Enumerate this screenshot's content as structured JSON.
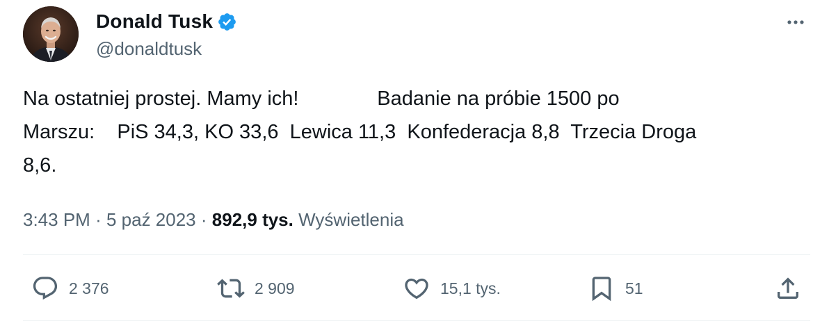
{
  "author": {
    "display_name": "Donald Tusk",
    "handle": "@donaldtusk",
    "verified": true
  },
  "tweet": {
    "line1": "Na ostatniej prostej. Mamy ich!              Badanie na próbie 1500 po",
    "line2": "Marszu:    PiS 34,3, KO 33,6  Lewica 11,3  Konfederacja 8,8  Trzecia Droga",
    "line3": "8,6."
  },
  "meta": {
    "time": "3:43 PM",
    "separator": "·",
    "date": "5 paź 2023",
    "views_count": "892,9 tys.",
    "views_label": "Wyświetlenia"
  },
  "actions": {
    "replies": "2 376",
    "retweets": "2 909",
    "likes": "15,1 tys.",
    "bookmarks": "51"
  },
  "colors": {
    "text": "#0f1419",
    "secondary": "#536471",
    "verified_blue": "#1d9bf0",
    "divider": "#eff3f4"
  },
  "icons": {
    "more": "more-horizontal-icon",
    "verified": "verified-badge-icon",
    "reply": "reply-bubble-icon",
    "retweet": "retweet-icon",
    "like": "heart-icon",
    "bookmark": "bookmark-icon",
    "share": "share-icon"
  }
}
